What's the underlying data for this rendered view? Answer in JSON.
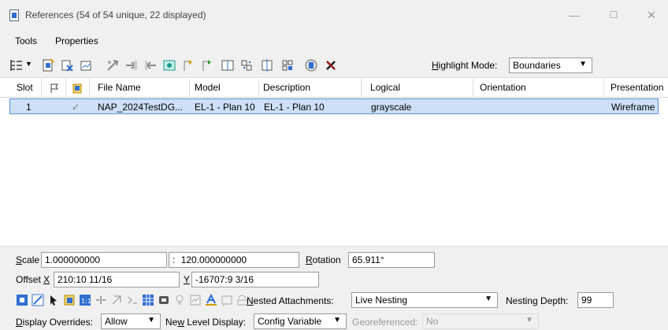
{
  "window": {
    "title": "References (54 of 54 unique, 22 displayed)",
    "minimize": "—",
    "maximize": "☐",
    "close": "✕"
  },
  "menu": {
    "tools": "Tools",
    "properties": "Properties"
  },
  "toolbar": {
    "highlight_mode_label": "Highlight Mode:",
    "highlight_mode_value": "Boundaries"
  },
  "table": {
    "columns": [
      "Slot",
      "",
      "",
      "File Name",
      "Model",
      "Description",
      "Logical",
      "Orientation",
      "Presentation"
    ],
    "rows": [
      {
        "slot": "1",
        "check": "✓",
        "file_name": "NAP_2024TestDG...",
        "model": "EL-1 - Plan 10",
        "description": "EL-1 - Plan 10",
        "logical": "grayscale",
        "orientation": "",
        "presentation": "Wireframe"
      }
    ]
  },
  "properties": {
    "scale_label": "Scale",
    "scale_value": "1.000000000",
    "scale_sep": ":",
    "scale_value2": "120.000000000",
    "rotation_label": "Rotation",
    "rotation_value": "65.911°",
    "offset_x_label": "Offset X",
    "offset_x_value": "210:10 11/16",
    "offset_y_label": "Y",
    "offset_y_value": "-16707:9 3/16",
    "nested_label": "Nested Attachments:",
    "nested_value": "Live Nesting",
    "nesting_depth_label": "Nesting Depth:",
    "nesting_depth_value": "99",
    "display_overrides_label": "Display Overrides:",
    "display_overrides_value": "Allow",
    "new_level_label": "New Level Display:",
    "new_level_value": "Config Variable",
    "georef_label": "Georeferenced:",
    "georef_value": "No"
  }
}
